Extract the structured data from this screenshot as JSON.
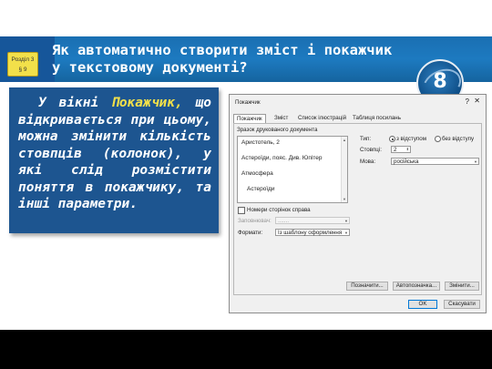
{
  "slide": {
    "badge": {
      "line1": "Розділ 3",
      "line2": "§ 9"
    },
    "title": "Як автоматично створити зміст і покажчик у текстовому документі?",
    "grade": "8",
    "text_before": "У вікні ",
    "text_highlight": "Покажчик,",
    "text_after": " що відкривається при цьому, можна змінити кількість стовпців (колонок), у які слід розмістити поняття в покажчику, та інші параметри."
  },
  "dialog": {
    "title": "Покажчик",
    "help": "?",
    "close": "✕",
    "tabs": [
      "Покажчик",
      "Зміст",
      "Список ілюстрацій",
      "Таблиця посилань"
    ],
    "preview_label": "Зразок друкованого документа",
    "preview_lines": [
      "Аристотель, 2",
      "Астероїди, пояс. Див. Юпітер",
      "Атмосфера",
      "Астероїди"
    ],
    "type_label": "Тип:",
    "type_options": [
      "з відступом",
      "без відступу"
    ],
    "columns_label": "Стовпці:",
    "columns_value": "2",
    "language_label": "Мова:",
    "language_value": "російська",
    "page_numbers_right": "Номери сторінок справа",
    "leader_label": "Заповнювач:",
    "leader_value": ".......",
    "formats_label": "Формати:",
    "formats_value": "Із шаблону оформлення",
    "buttons": {
      "mark_entry": "Позначити...",
      "automark": "Автопозначка...",
      "modify": "Змінити...",
      "ok": "OK",
      "cancel": "Скасувати"
    }
  }
}
